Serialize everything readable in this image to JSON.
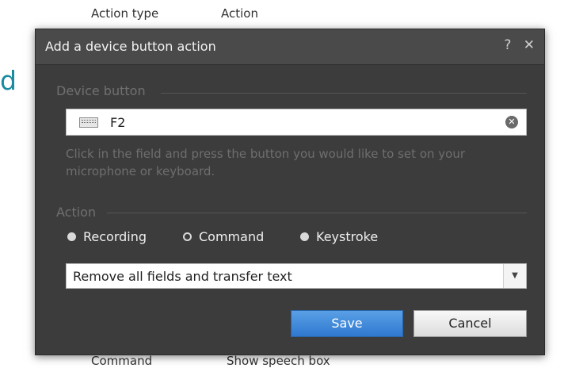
{
  "background": {
    "header": {
      "col1": "Action type",
      "col2": "Action"
    },
    "partial_letter": "d",
    "footer": {
      "col1": "Command",
      "col2": "Show speech box"
    }
  },
  "dialog": {
    "title": "Add a device button action",
    "help_label": "?",
    "close_label": "✕",
    "device_section": {
      "label": "Device button",
      "field_value": "F2",
      "clear_label": "✕",
      "hint": "Click in the field and press the button you would like to set on your microphone or keyboard."
    },
    "action_section": {
      "label": "Action",
      "options": [
        {
          "label": "Recording",
          "selected": false
        },
        {
          "label": "Command",
          "selected": true
        },
        {
          "label": "Keystroke",
          "selected": false
        }
      ],
      "dropdown_value": "Remove all fields and transfer text",
      "dropdown_arrow": "▼"
    },
    "buttons": {
      "save": "Save",
      "cancel": "Cancel"
    }
  },
  "colors": {
    "dialog_bg": "#3c3c3c",
    "titlebar_bg": "#4a4a4a",
    "primary_button": "#2f78cf",
    "accent_letter": "#1a8aa0"
  },
  "icons": {
    "keyboard": "keyboard-icon",
    "clear": "clear-icon",
    "help": "help-icon",
    "close": "close-icon",
    "dropdown": "chevron-down-icon"
  }
}
